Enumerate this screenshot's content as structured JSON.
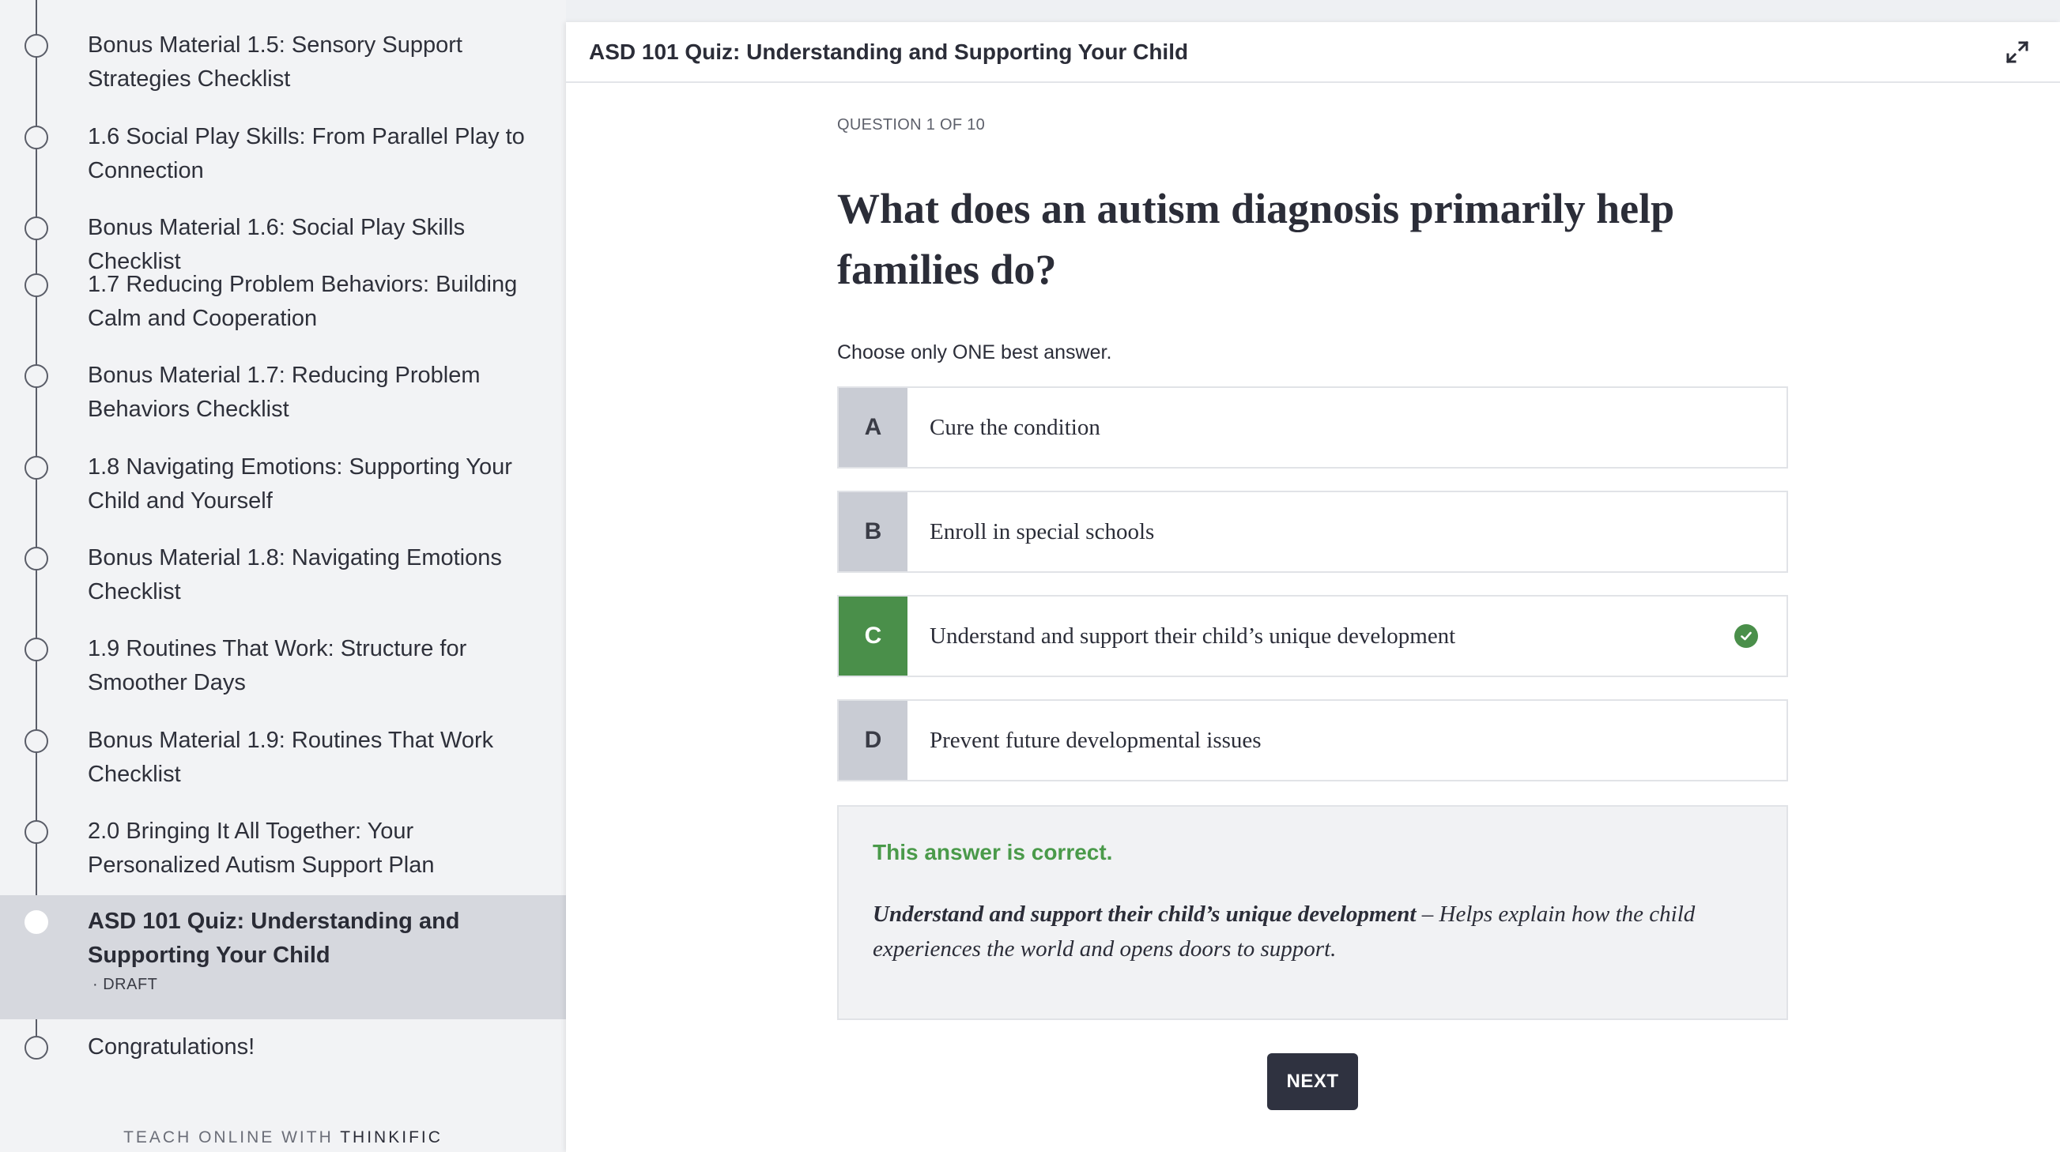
{
  "sidebar": {
    "lessons": [
      {
        "title": "Bonus Material 1.5: Sensory Support Strategies Checklist"
      },
      {
        "title": "1.6 Social Play Skills: From Parallel Play to Connection"
      },
      {
        "title": "Bonus Material 1.6: Social Play Skills Checklist"
      },
      {
        "title": "1.7 Reducing Problem Behaviors: Building Calm and Cooperation"
      },
      {
        "title": "Bonus Material 1.7: Reducing Problem Behaviors Checklist"
      },
      {
        "title": "1.8 Navigating Emotions: Supporting Your Child and Yourself"
      },
      {
        "title": "Bonus Material 1.8: Navigating Emotions Checklist"
      },
      {
        "title": "1.9 Routines That Work: Structure for Smoother Days"
      },
      {
        "title": "Bonus Material 1.9: Routines That Work Checklist"
      },
      {
        "title": "2.0 Bringing It All Together: Your Personalized Autism Support Plan"
      },
      {
        "title": "ASD 101 Quiz: Understanding and Supporting Your Child",
        "status": "DRAFT"
      },
      {
        "title": "Congratulations!"
      }
    ],
    "footer": {
      "prefix": "TEACH ONLINE WITH",
      "brand": "THINKIFIC"
    }
  },
  "header": {
    "title": "ASD 101 Quiz: Understanding and Supporting Your Child",
    "expand_icon": "expand-icon"
  },
  "quiz": {
    "progress": "QUESTION 1 OF 10",
    "question": "What does an autism diagnosis primarily help families do?",
    "instruction": "Choose only ONE best answer.",
    "answers": [
      {
        "letter": "A",
        "text": "Cure the condition",
        "correct": false
      },
      {
        "letter": "B",
        "text": "Enroll in special schools",
        "correct": false
      },
      {
        "letter": "C",
        "text": "Understand and support their child’s unique development",
        "correct": true
      },
      {
        "letter": "D",
        "text": "Prevent future developmental issues",
        "correct": false
      }
    ],
    "feedback": {
      "verdict": "This answer is correct.",
      "answer_bold": "Understand and support their child’s unique development",
      "explanation": " – Helps explain how the child experiences the world and opens doors to support."
    },
    "next_label": "NEXT"
  },
  "colors": {
    "correct": "#4a8f4a",
    "verdict_text": "#4a9a4a",
    "letter_bg": "#c9ccd4",
    "active_lesson_bg": "#d6d8de",
    "next_button_bg": "#2f3240"
  }
}
